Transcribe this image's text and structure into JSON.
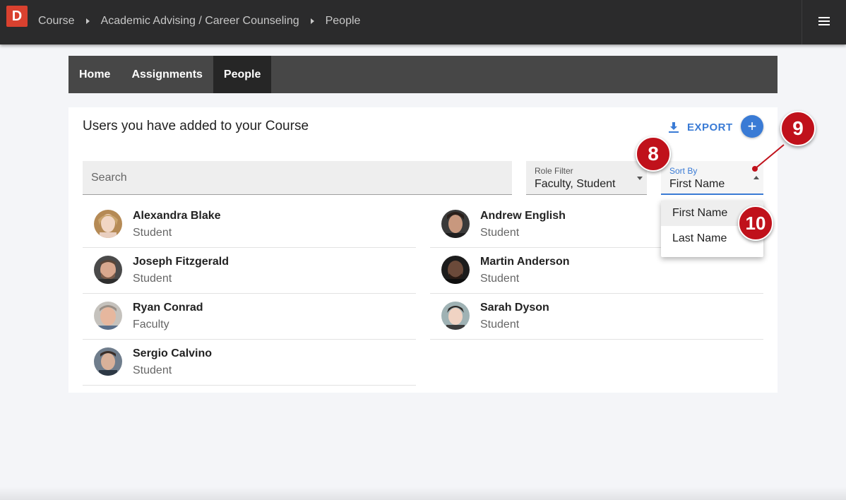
{
  "app": {
    "logo_letter": "D",
    "brand_color": "#d9412f"
  },
  "breadcrumb": [
    "Course",
    "Academic Advising / Career Counseling",
    "People"
  ],
  "tabs": [
    {
      "label": "Home",
      "active": false
    },
    {
      "label": "Assignments",
      "active": false
    },
    {
      "label": "People",
      "active": true
    }
  ],
  "main": {
    "title": "Users you have added to your Course",
    "export_label": "EXPORT",
    "add_label": "+",
    "search_placeholder": "Search",
    "role_filter": {
      "label": "Role Filter",
      "value": "Faculty, Student"
    },
    "sort_by": {
      "label": "Sort By",
      "value": "First Name",
      "options": [
        "First Name",
        "Last Name"
      ]
    }
  },
  "people_left": [
    {
      "name": "Alexandra Blake",
      "role": "Student"
    },
    {
      "name": "Joseph Fitzgerald",
      "role": "Student"
    },
    {
      "name": "Ryan Conrad",
      "role": "Faculty"
    },
    {
      "name": "Sergio Calvino",
      "role": "Student"
    }
  ],
  "people_right": [
    {
      "name": "Andrew English",
      "role": "Student"
    },
    {
      "name": "Martin Anderson",
      "role": "Student"
    },
    {
      "name": "Sarah Dyson",
      "role": "Student"
    }
  ],
  "callouts": [
    "8",
    "9",
    "10"
  ],
  "colors": {
    "accent": "#3a7bd5",
    "callout": "#c0111b",
    "topbar": "#2b2b2c"
  }
}
